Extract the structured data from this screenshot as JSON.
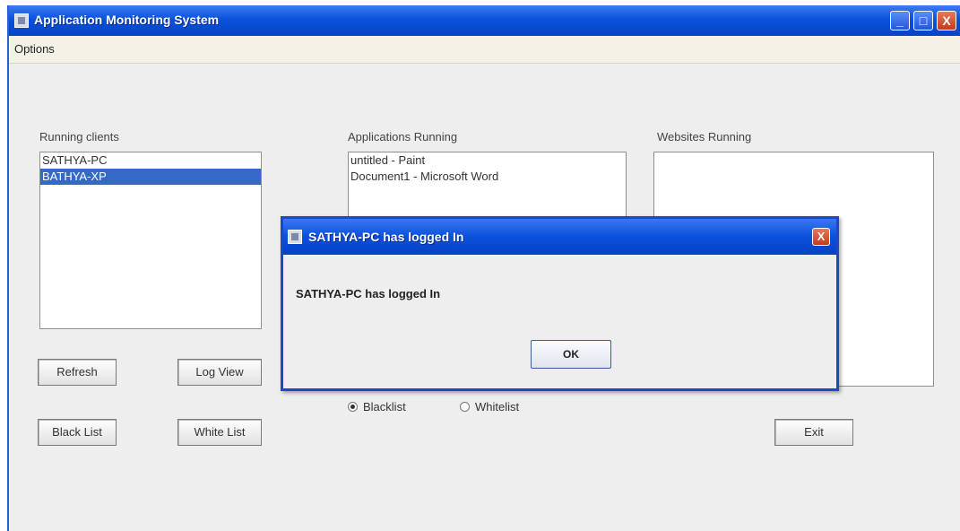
{
  "window": {
    "title": "Application Monitoring System",
    "min_glyph": "_",
    "max_glyph": "□",
    "close_glyph": "X"
  },
  "menu": {
    "options_label": "Options"
  },
  "panels": {
    "clients_label": "Running clients",
    "apps_label": "Applications Running",
    "websites_label": "Websites Running"
  },
  "clients": [
    {
      "name": "SATHYA-PC",
      "selected": false
    },
    {
      "name": "BATHYA-XP",
      "selected": true
    }
  ],
  "applications": [
    "untitled - Paint",
    "Document1 - Microsoft Word"
  ],
  "websites": [],
  "buttons": {
    "refresh": "Refresh",
    "log_view": "Log View",
    "black_list": "Black List",
    "white_list": "White List",
    "exit": "Exit"
  },
  "filter_mode": {
    "blacklist_label": "Blacklist",
    "whitelist_label": "Whitelist",
    "selected": "Blacklist"
  },
  "dialog": {
    "title": "SATHYA-PC has logged In",
    "message": "SATHYA-PC has logged In",
    "ok_label": "OK",
    "close_glyph": "X"
  },
  "colors": {
    "titlebar": "#0a52de",
    "selection": "#3569c7",
    "dialog_border": "#1f49c4"
  }
}
